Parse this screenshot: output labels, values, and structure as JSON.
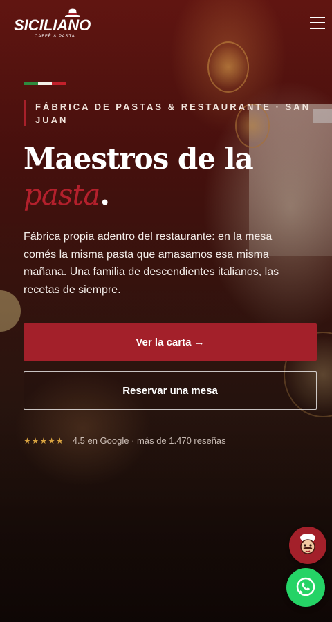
{
  "header": {
    "logo_text": "SICILIANO",
    "logo_subtitle": "CAFFÈ & PASTA",
    "menu_icon": "hamburger-icon"
  },
  "hero": {
    "eyebrow": "FÁBRICA DE PASTAS & RESTAURANTE · SAN JUAN",
    "title_main": "Maestros de la",
    "title_accent": "pasta",
    "title_end": ".",
    "lead": "Fábrica propia adentro del restaurante: en la mesa comés la misma pasta que amasamos esa misma mañana. Una familia de descendientes italianos, las recetas de siempre.",
    "primary_cta": "Ver la carta →",
    "secondary_cta": "Reservar una mesa",
    "rating_stars": "★★★★★",
    "rating_value": 4.5,
    "rating_text": "4.5 en Google · más de 1.470 reseñas"
  },
  "floating": {
    "chef_icon": "chef-avatar-icon",
    "whatsapp_icon": "whatsapp-icon"
  },
  "colors": {
    "accent": "#a3202a",
    "flag_green": "#2e8b3e",
    "flag_white": "#f3f0e8",
    "flag_red": "#c3202b",
    "star": "#d9a441",
    "whatsapp": "#25d366"
  }
}
